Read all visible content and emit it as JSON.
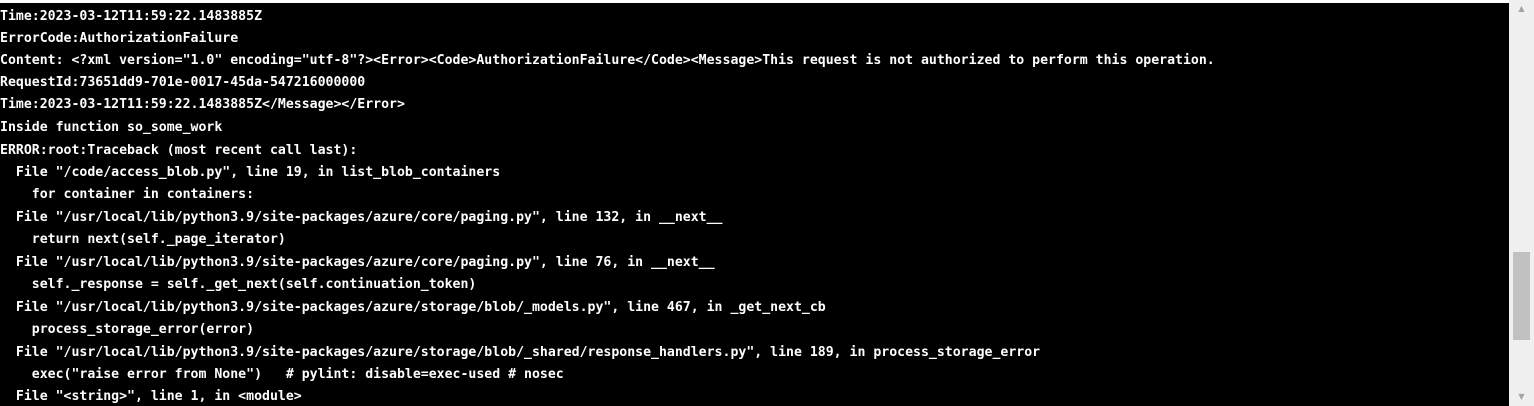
{
  "console": {
    "lines": [
      "Time:2023-03-12T11:59:22.1483885Z",
      "ErrorCode:AuthorizationFailure",
      "Content: <?xml version=\"1.0\" encoding=\"utf-8\"?><Error><Code>AuthorizationFailure</Code><Message>This request is not authorized to perform this operation.",
      "RequestId:73651dd9-701e-0017-45da-547216000000",
      "Time:2023-03-12T11:59:22.1483885Z</Message></Error>",
      "Inside function so_some_work",
      "ERROR:root:Traceback (most recent call last):",
      "  File \"/code/access_blob.py\", line 19, in list_blob_containers",
      "    for container in containers:",
      "  File \"/usr/local/lib/python3.9/site-packages/azure/core/paging.py\", line 132, in __next__",
      "    return next(self._page_iterator)",
      "  File \"/usr/local/lib/python3.9/site-packages/azure/core/paging.py\", line 76, in __next__",
      "    self._response = self._get_next(self.continuation_token)",
      "  File \"/usr/local/lib/python3.9/site-packages/azure/storage/blob/_models.py\", line 467, in _get_next_cb",
      "    process_storage_error(error)",
      "  File \"/usr/local/lib/python3.9/site-packages/azure/storage/blob/_shared/response_handlers.py\", line 189, in process_storage_error",
      "    exec(\"raise error from None\")   # pylint: disable=exec-used # nosec",
      "  File \"<string>\", line 1, in <module>"
    ]
  },
  "scrollbar": {
    "up_icon": "triangle-up-icon",
    "down_icon": "triangle-down-icon",
    "up_glyph": "▲",
    "down_glyph": "▼"
  },
  "colors": {
    "console_background": "#000000",
    "console_text": "#ffffff",
    "scrollbar_track": "#f0f0f0",
    "scrollbar_thumb": "#c1c1c1"
  }
}
